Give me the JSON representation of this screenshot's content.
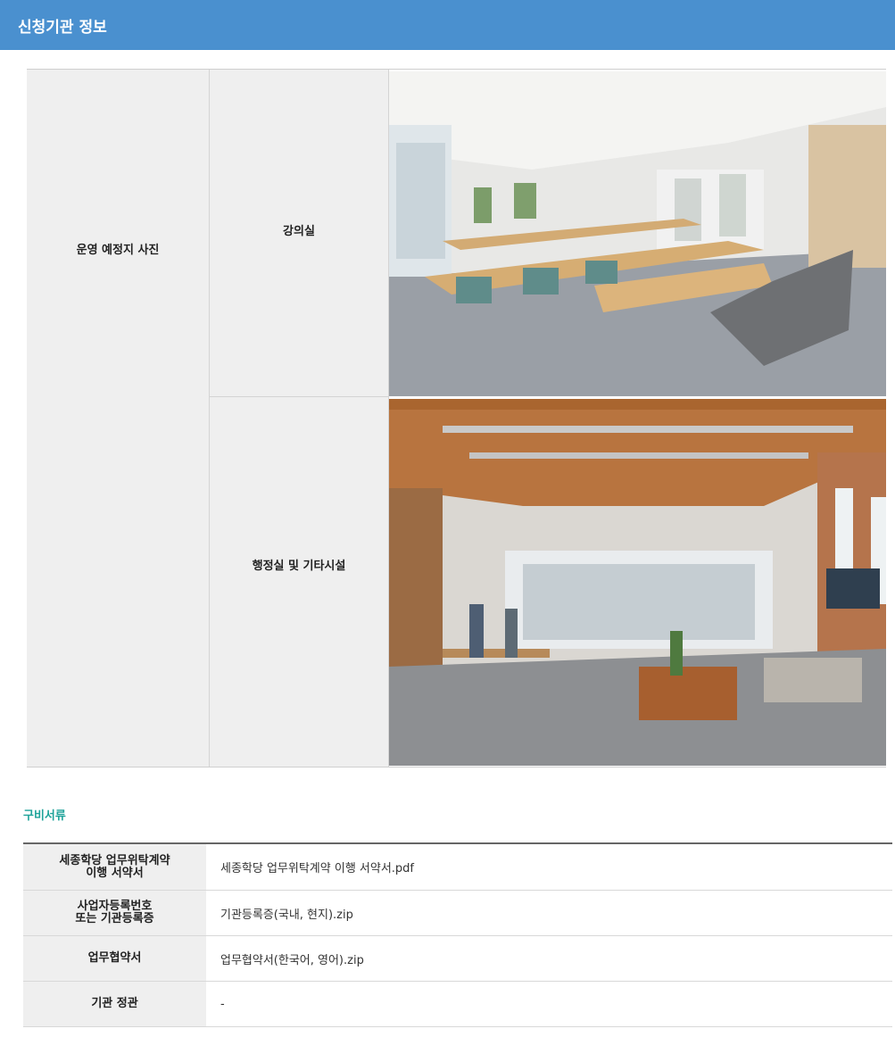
{
  "header": {
    "title": "신청기관 정보"
  },
  "photos": {
    "label": "운영 예정지 사진",
    "rows": [
      {
        "label": "강의실",
        "image": "classroom-photo"
      },
      {
        "label": "행정실 및 기타시설",
        "image": "office-photo"
      }
    ]
  },
  "documents": {
    "title": "구비서류",
    "rows": [
      {
        "label": "세종학당 업무위탁계약\n이행 서약서",
        "value": "세종학당 업무위탁계약 이행 서약서.pdf"
      },
      {
        "label": "사업자등록번호\n또는 기관등록증",
        "value": "기관등록증(국내, 현지).zip"
      },
      {
        "label": "업무협약서",
        "value": "업무협약서(한국어, 영어).zip"
      },
      {
        "label": "기관 정관",
        "value": "-"
      }
    ]
  },
  "colors": {
    "header_bg": "#4a90cf",
    "section_title": "#1fa39a",
    "label_bg": "#efefef"
  }
}
